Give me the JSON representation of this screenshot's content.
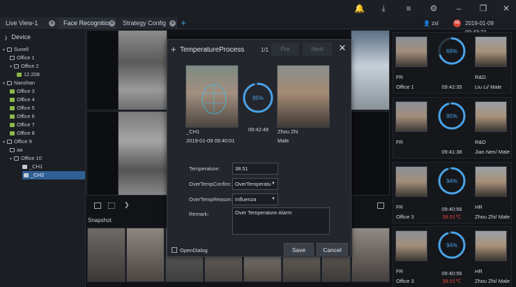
{
  "tabs": [
    {
      "label": "Live View-1"
    },
    {
      "label": "Face Recognition"
    },
    {
      "label": "Strategy Config"
    }
  ],
  "top_icons": [
    "bell-icon",
    "download-icon",
    "menu-icon",
    "gear-icon",
    "minimize-icon",
    "restore-icon",
    "close-icon"
  ],
  "user": {
    "name": "zxl",
    "badge": "66",
    "datetime": "2019-01-09 09:43:21"
  },
  "sidebar": {
    "title": "Device",
    "tree": [
      {
        "label": "Sunell",
        "kind": "org"
      },
      {
        "label": "Office 1",
        "kind": "org"
      },
      {
        "label": "Office 2",
        "kind": "org"
      },
      {
        "label": "12.208",
        "kind": "cam"
      },
      {
        "label": "Nanshan",
        "kind": "org"
      },
      {
        "label": "Office 3",
        "kind": "cam"
      },
      {
        "label": "Office 4",
        "kind": "cam"
      },
      {
        "label": "Office 5",
        "kind": "cam"
      },
      {
        "label": "Office 6",
        "kind": "cam"
      },
      {
        "label": "Office 7",
        "kind": "cam"
      },
      {
        "label": "Office 8",
        "kind": "cam"
      },
      {
        "label": "Office 9",
        "kind": "org"
      },
      {
        "label": "aa",
        "kind": "org"
      },
      {
        "label": "Office 10",
        "kind": "org"
      },
      {
        "label": "_CH1",
        "kind": "ch"
      },
      {
        "label": "_CH2",
        "kind": "ch",
        "selected": true
      }
    ]
  },
  "snapshot": {
    "title": "Snapshot"
  },
  "cards": [
    {
      "group": "FR",
      "location": "Office 1",
      "score": "69%",
      "score_value": 69,
      "time": "09:42:35",
      "temp": "",
      "dept": "R&D",
      "name": "Liu Li/ Male"
    },
    {
      "group": "FR",
      "location": "",
      "score": "95%",
      "score_value": 95,
      "time": "09:41:38",
      "temp": "",
      "dept": "R&D",
      "name": "Jian Nen/ Male"
    },
    {
      "group": "FR",
      "location": "Office 3",
      "score": "94%",
      "score_value": 94,
      "time": "09:40:56",
      "temp": "38.51℃",
      "dept": "HR",
      "name": "Zhou Zhi/ Male"
    },
    {
      "group": "FR",
      "location": "Office 3",
      "score": "94%",
      "score_value": 94,
      "time": "09:40:56",
      "temp": "38.51℃",
      "dept": "HR",
      "name": "Zhou Zhi/ Male"
    }
  ],
  "modal": {
    "title": "TemperatureProcess",
    "page": "1/1",
    "pre_label": "Pre",
    "next_label": "Next",
    "capture_channel": "_CH1",
    "capture_datetime": "2019-01-09 09:40:01",
    "match_score": "95%",
    "match_score_value": 95,
    "match_time": "09:42:48",
    "match_name": "Zhou Zhi",
    "match_gender": "Male",
    "temperature_label": "Temperature:",
    "temperature_value": "38.51",
    "confirm_label": "OverTempConfim:",
    "confirm_value": "OverTemperatu",
    "reason_label": "OverTempReason:",
    "reason_value": "Influenza",
    "remark_label": "Remark:",
    "remark_value": "Over Temperature Alarm",
    "open_dialog_label": "OpenDialog",
    "save_label": "Save",
    "cancel_label": "Cancel"
  },
  "colors": {
    "accent": "#4aa3e8",
    "alert": "#e8463a",
    "selected": "#2f5f95"
  }
}
